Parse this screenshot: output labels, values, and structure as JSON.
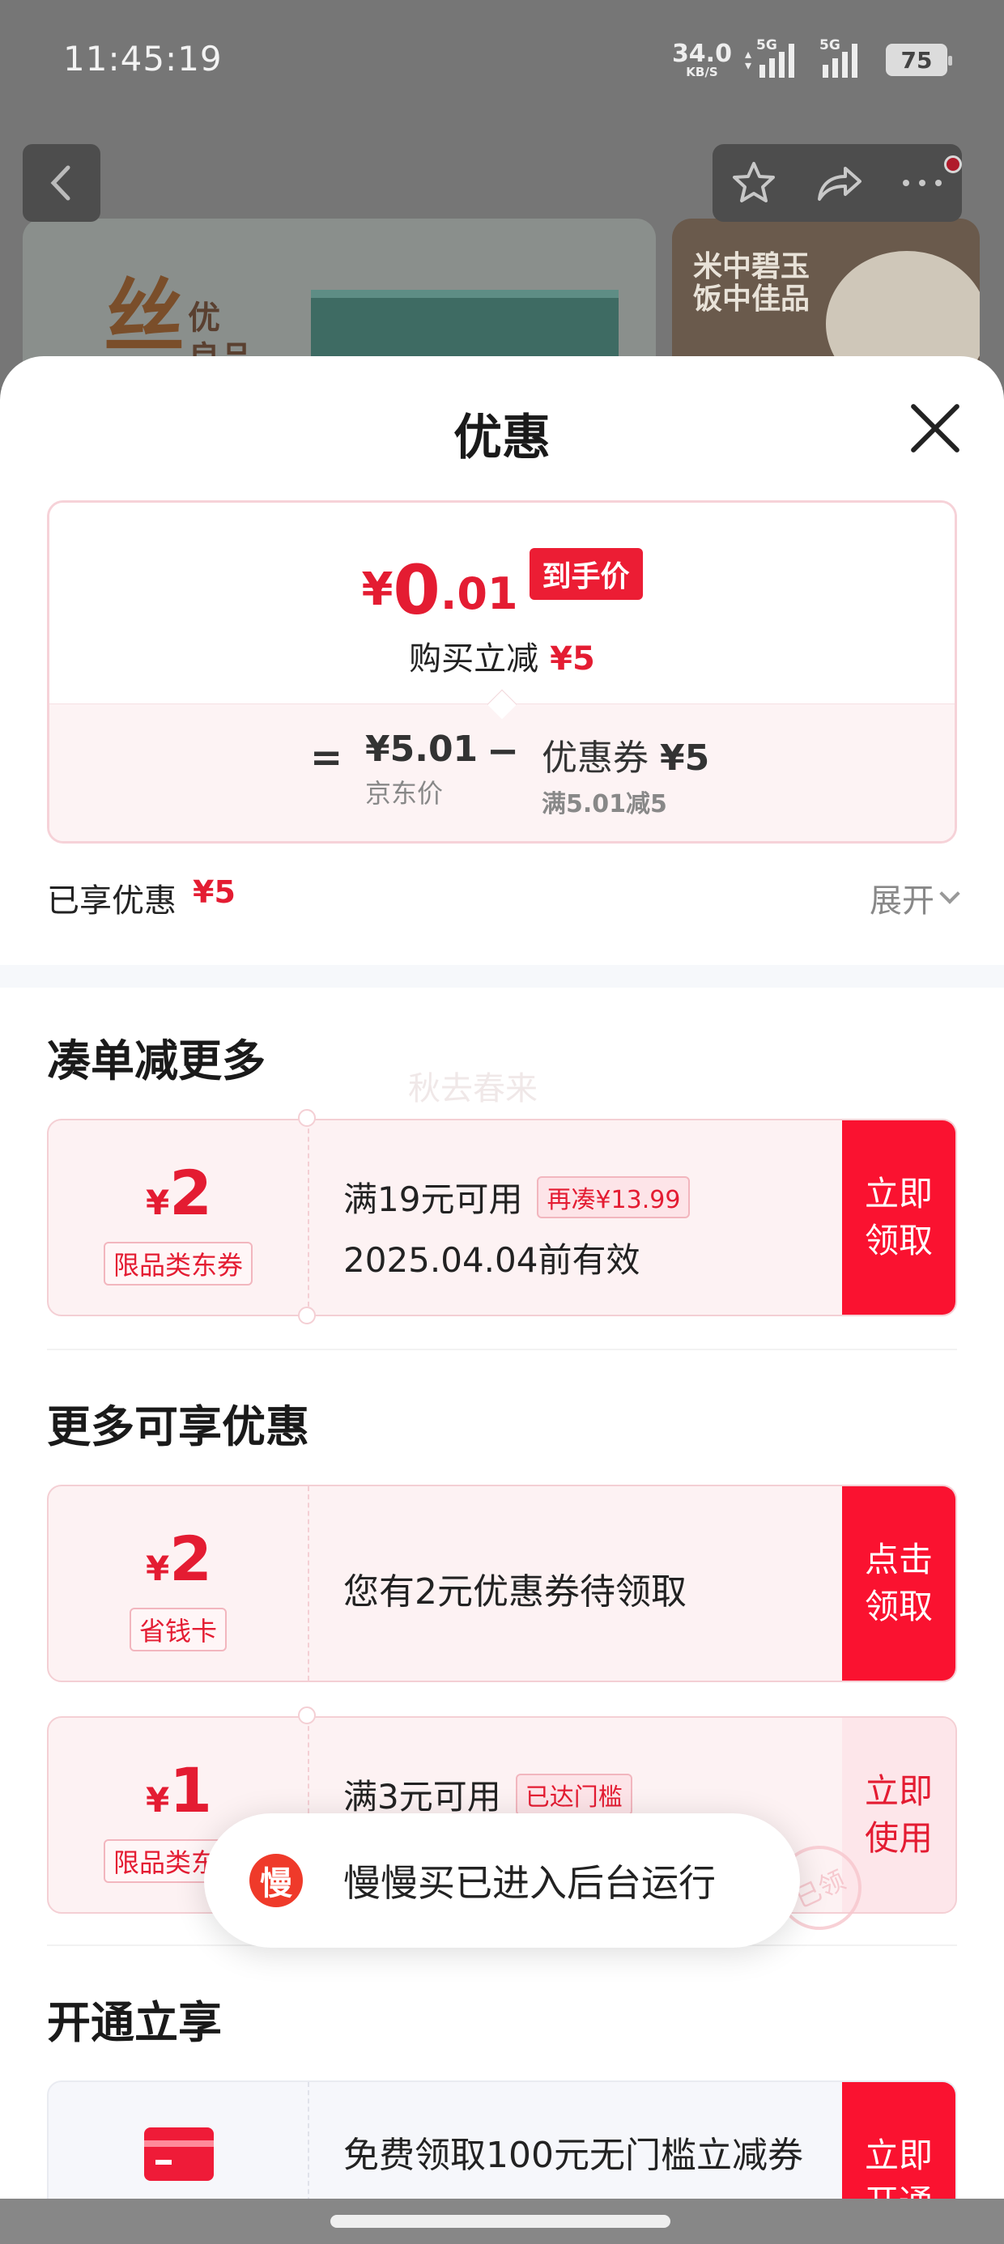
{
  "status_bar": {
    "time": "11:45:19",
    "net_speed": "34.0",
    "net_unit": "KB/S",
    "signal1": "5G",
    "signal2": "5G",
    "battery": "75"
  },
  "background_page": {
    "banner_left_big": "丝",
    "banner_left_small": "优",
    "banner_left_small2": "良品",
    "banner_right_text": "米中碧玉\n饭中佳品",
    "icons": [
      "back-arrow-icon",
      "star-icon",
      "share-icon",
      "more-icon"
    ]
  },
  "sheet": {
    "title": "优惠",
    "price_card": {
      "currency": "¥",
      "final_int": "0",
      "final_dec": ".01",
      "final_badge": "到手价",
      "reduce_label": "购买立减",
      "reduce_amount": "¥5",
      "equals": "=",
      "jd_price": "¥5.01",
      "jd_label": "京东价",
      "minus": "−",
      "coupon_label": "优惠券",
      "coupon_value": "¥5",
      "coupon_rule": "满5.01减5"
    },
    "enjoyed": {
      "label": "已享优惠",
      "value": "¥5",
      "expand": "展开"
    },
    "section1": {
      "title": "凑单减更多",
      "watermark": "秋去春来",
      "coupon": {
        "currency": "¥",
        "amount": "2",
        "tag": "限品类东券",
        "line1": "满19元可用",
        "pill": "再凑¥13.99",
        "line2": "2025.04.04前有效",
        "action": "立即领取"
      }
    },
    "section2": {
      "title": "更多可享优惠",
      "coupons": [
        {
          "currency": "¥",
          "amount": "2",
          "tag": "省钱卡",
          "text": "您有2元优惠券待领取",
          "action": "点击领取"
        },
        {
          "currency": "¥",
          "amount": "1",
          "tag": "限品类东券",
          "line1": "满3元可用",
          "pill": "已达门槛",
          "action": "立即使用",
          "stamp": "已领"
        }
      ]
    },
    "section3": {
      "title": "开通立享",
      "coupon": {
        "text": "免费领取100元无门槛立减券",
        "action": "立即开通"
      }
    }
  },
  "toast": {
    "icon_char": "慢",
    "text": "慢慢买已进入后台运行"
  },
  "colors": {
    "accent": "#fa1230",
    "price_red": "#e41c32",
    "coupon_bg": "#fdf2f3"
  }
}
